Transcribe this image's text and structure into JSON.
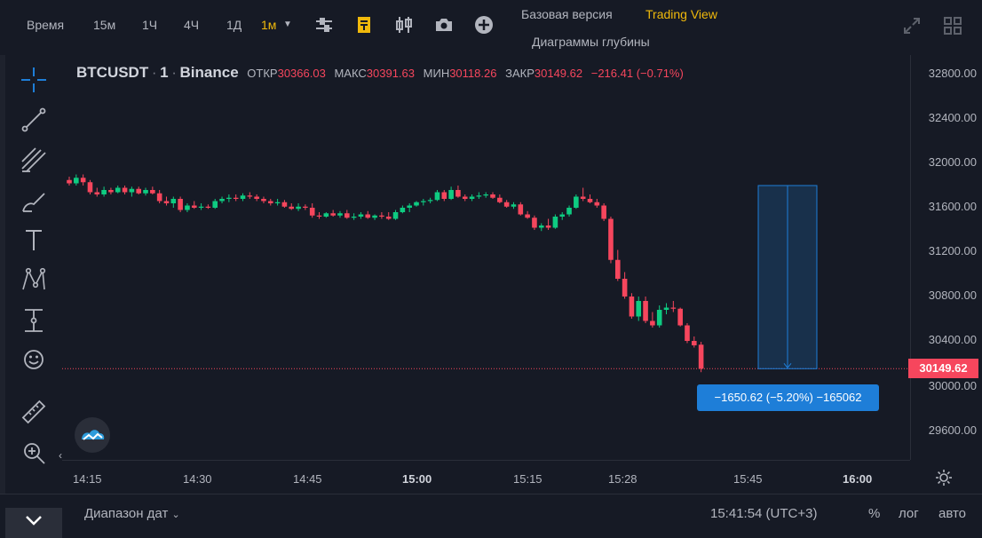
{
  "toolbar": {
    "time_label": "Время",
    "intervals": [
      "15м",
      "1Ч",
      "4Ч",
      "1Д"
    ],
    "active_interval": "1м",
    "tabs": {
      "basic": "Базовая версия",
      "tradingview": "Trading View",
      "depth": "Диаграммы глубины"
    },
    "icons": [
      "indicators-icon",
      "chart-type-icon",
      "candles-icon",
      "camera-icon",
      "add-icon",
      "fullscreen-icon",
      "layout-grid-icon"
    ]
  },
  "legend": {
    "symbol": "BTCUSDT",
    "interval": "1",
    "exchange": "Binance",
    "open_label": "ОТКР",
    "open": "30366.03",
    "high_label": "МАКС",
    "high": "30391.63",
    "low_label": "МИН",
    "low": "30118.26",
    "close_label": "ЗАКР",
    "close": "30149.62",
    "change": "−216.41 (−0.71%)"
  },
  "measure": {
    "label": "−1650.62 (−5.20%) −165062"
  },
  "price_axis": {
    "ticks": [
      "32800.00",
      "32400.00",
      "32000.00",
      "31600.00",
      "31200.00",
      "30800.00",
      "30400.00",
      "30000.00",
      "29600.00"
    ],
    "last_price": "30149.62"
  },
  "time_axis": {
    "ticks": [
      "14:15",
      "14:30",
      "14:45",
      "15:00",
      "15:15",
      "15:28",
      "15:45",
      "16:00"
    ],
    "bold_ticks": [
      "15:00",
      "16:00"
    ]
  },
  "bottom": {
    "date_range": "Диапазон дат",
    "clock": "15:41:54 (UTC+3)",
    "percent": "%",
    "log": "лог",
    "auto": "авто"
  },
  "colors": {
    "up": "#0ecb81",
    "down": "#f6465d",
    "accent": "#f0b90b",
    "measure": "#1e7ed8",
    "background": "#161a25"
  },
  "chart_data": {
    "type": "candlestick",
    "title": "",
    "xlabel": "",
    "ylabel": "",
    "ylim": [
      29400,
      32900
    ],
    "x_range": [
      "14:15",
      "16:05"
    ],
    "ohlc": [
      [
        31850,
        31880,
        31800,
        31820
      ],
      [
        31820,
        31900,
        31800,
        31870
      ],
      [
        31870,
        31900,
        31800,
        31830
      ],
      [
        31830,
        31850,
        31720,
        31740
      ],
      [
        31740,
        31780,
        31700,
        31720
      ],
      [
        31720,
        31790,
        31700,
        31760
      ],
      [
        31760,
        31780,
        31720,
        31740
      ],
      [
        31740,
        31800,
        31730,
        31780
      ],
      [
        31780,
        31800,
        31720,
        31740
      ],
      [
        31740,
        31790,
        31700,
        31770
      ],
      [
        31770,
        31790,
        31720,
        31730
      ],
      [
        31730,
        31780,
        31710,
        31760
      ],
      [
        31760,
        31790,
        31720,
        31730
      ],
      [
        31730,
        31760,
        31640,
        31660
      ],
      [
        31660,
        31700,
        31620,
        31640
      ],
      [
        31640,
        31700,
        31600,
        31680
      ],
      [
        31680,
        31700,
        31560,
        31580
      ],
      [
        31580,
        31640,
        31560,
        31620
      ],
      [
        31620,
        31660,
        31590,
        31600
      ],
      [
        31600,
        31640,
        31580,
        31610
      ],
      [
        31610,
        31630,
        31590,
        31600
      ],
      [
        31600,
        31680,
        31590,
        31660
      ],
      [
        31660,
        31700,
        31640,
        31680
      ],
      [
        31680,
        31720,
        31650,
        31690
      ],
      [
        31690,
        31720,
        31660,
        31680
      ],
      [
        31680,
        31730,
        31660,
        31710
      ],
      [
        31710,
        31740,
        31680,
        31700
      ],
      [
        31700,
        31720,
        31660,
        31680
      ],
      [
        31680,
        31700,
        31640,
        31660
      ],
      [
        31660,
        31680,
        31620,
        31640
      ],
      [
        31640,
        31680,
        31620,
        31650
      ],
      [
        31650,
        31670,
        31600,
        31610
      ],
      [
        31610,
        31640,
        31580,
        31590
      ],
      [
        31590,
        31640,
        31570,
        31610
      ],
      [
        31610,
        31630,
        31580,
        31600
      ],
      [
        31600,
        31640,
        31510,
        31530
      ],
      [
        31530,
        31560,
        31500,
        31520
      ],
      [
        31520,
        31560,
        31510,
        31550
      ],
      [
        31550,
        31580,
        31520,
        31530
      ],
      [
        31530,
        31570,
        31510,
        31550
      ],
      [
        31550,
        31580,
        31500,
        31510
      ],
      [
        31510,
        31550,
        31490,
        31520
      ],
      [
        31520,
        31560,
        31500,
        31540
      ],
      [
        31540,
        31570,
        31500,
        31510
      ],
      [
        31510,
        31540,
        31490,
        31530
      ],
      [
        31530,
        31560,
        31500,
        31520
      ],
      [
        31520,
        31560,
        31490,
        31500
      ],
      [
        31500,
        31580,
        31490,
        31560
      ],
      [
        31560,
        31620,
        31550,
        31600
      ],
      [
        31600,
        31640,
        31560,
        31620
      ],
      [
        31620,
        31660,
        31610,
        31650
      ],
      [
        31650,
        31680,
        31620,
        31660
      ],
      [
        31660,
        31690,
        31640,
        31670
      ],
      [
        31670,
        31760,
        31660,
        31740
      ],
      [
        31740,
        31760,
        31660,
        31680
      ],
      [
        31680,
        31790,
        31670,
        31760
      ],
      [
        31760,
        31800,
        31690,
        31700
      ],
      [
        31700,
        31720,
        31660,
        31680
      ],
      [
        31680,
        31720,
        31660,
        31700
      ],
      [
        31700,
        31740,
        31680,
        31710
      ],
      [
        31710,
        31740,
        31690,
        31720
      ],
      [
        31720,
        31740,
        31680,
        31690
      ],
      [
        31690,
        31720,
        31640,
        31650
      ],
      [
        31650,
        31670,
        31600,
        31610
      ],
      [
        31610,
        31650,
        31590,
        31630
      ],
      [
        31630,
        31650,
        31530,
        31540
      ],
      [
        31540,
        31570,
        31500,
        31510
      ],
      [
        31510,
        31530,
        31400,
        31420
      ],
      [
        31420,
        31460,
        31390,
        31440
      ],
      [
        31440,
        31500,
        31400,
        31420
      ],
      [
        31420,
        31540,
        31410,
        31520
      ],
      [
        31520,
        31560,
        31490,
        31540
      ],
      [
        31540,
        31620,
        31520,
        31600
      ],
      [
        31600,
        31720,
        31590,
        31700
      ],
      [
        31700,
        31780,
        31660,
        31680
      ],
      [
        31680,
        31720,
        31640,
        31650
      ],
      [
        31650,
        31680,
        31600,
        31620
      ],
      [
        31620,
        31640,
        31480,
        31500
      ],
      [
        31500,
        31520,
        31100,
        31130
      ],
      [
        31130,
        31220,
        30940,
        30960
      ],
      [
        30960,
        31020,
        30780,
        30800
      ],
      [
        30800,
        30830,
        30600,
        30620
      ],
      [
        30620,
        30800,
        30580,
        30760
      ],
      [
        30760,
        30800,
        30560,
        30580
      ],
      [
        30580,
        30660,
        30520,
        30540
      ],
      [
        30540,
        30720,
        30520,
        30680
      ],
      [
        30680,
        30740,
        30640,
        30700
      ],
      [
        30700,
        30760,
        30660,
        30690
      ],
      [
        30690,
        30700,
        30530,
        30540
      ],
      [
        30540,
        30560,
        30380,
        30400
      ],
      [
        30400,
        30440,
        30340,
        30360
      ],
      [
        30366.03,
        30391.63,
        30118.26,
        30149.62
      ]
    ]
  }
}
